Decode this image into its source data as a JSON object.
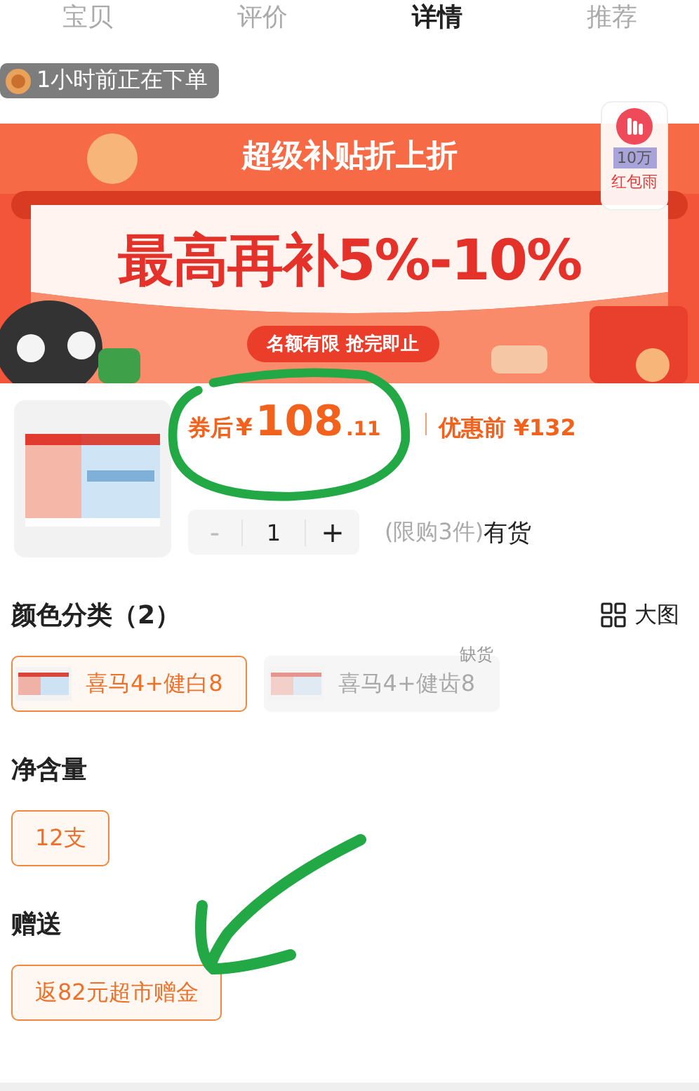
{
  "tabs": [
    {
      "label": "宝贝",
      "selected": false
    },
    {
      "label": "评价",
      "selected": false
    },
    {
      "label": "详情",
      "selected": true
    },
    {
      "label": "推荐",
      "selected": false
    }
  ],
  "toast": {
    "text": "1小时前正在下单"
  },
  "banner": {
    "title": "超级补贴折上折",
    "headline": "最高再补5%-10%",
    "pill": "名额有限 抢完即止"
  },
  "float_badge": {
    "count": "10万",
    "label": "红包雨"
  },
  "price": {
    "prefix": "券后",
    "currency": "¥",
    "integer": "108",
    "decimal": ".11",
    "original": "优惠前 ¥132"
  },
  "stepper": {
    "minus": "-",
    "value": "1",
    "plus": "+",
    "limit": "(限购3件)",
    "stock": "有货"
  },
  "sections": [
    {
      "title": "颜色分类（2）",
      "action": "大图",
      "options": [
        {
          "label": "喜马4+健白8",
          "selected": true,
          "disabled": false,
          "thumb": true
        },
        {
          "label": "喜马4+健齿8",
          "selected": false,
          "disabled": true,
          "thumb": true,
          "badge": "缺货"
        }
      ]
    },
    {
      "title": "净含量",
      "options": [
        {
          "label": "12支",
          "selected": true,
          "disabled": false,
          "thumb": false
        }
      ]
    },
    {
      "title": "赠送",
      "options": [
        {
          "label": "返82元超市赠金",
          "selected": true,
          "disabled": false,
          "thumb": false
        }
      ]
    }
  ]
}
